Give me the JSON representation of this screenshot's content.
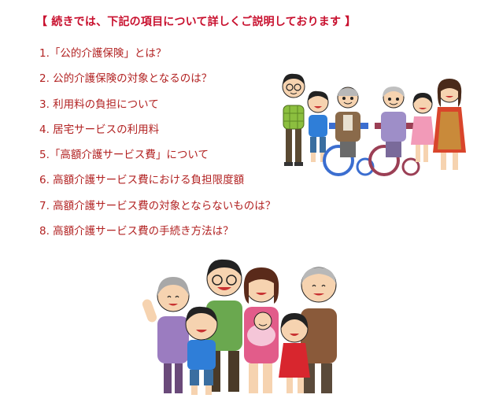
{
  "heading": "【 続きでは、下記の項目について詳しくご説明しております 】",
  "toc": [
    {
      "label": "1.「公的介護保険」とは？"
    },
    {
      "label": "2. 公的介護保険の対象となるのは？"
    },
    {
      "label": "3. 利用料の負担について"
    },
    {
      "label": "4. 居宅サービスの利用料"
    },
    {
      "label": "5.「高額介護サービス費」について"
    },
    {
      "label": "6. 高額介護サービス費における負担限度額"
    },
    {
      "label": "7. 高額介護サービス費の対象とならないものは？"
    },
    {
      "label": "8. 高額介護サービス費の手続き方法は？"
    }
  ],
  "images": {
    "top": "family-with-wheelchair-grandparents-illustration",
    "bottom": "three-generation-family-illustration"
  },
  "colors": {
    "accent": "#c8102e",
    "link": "#b22222"
  }
}
